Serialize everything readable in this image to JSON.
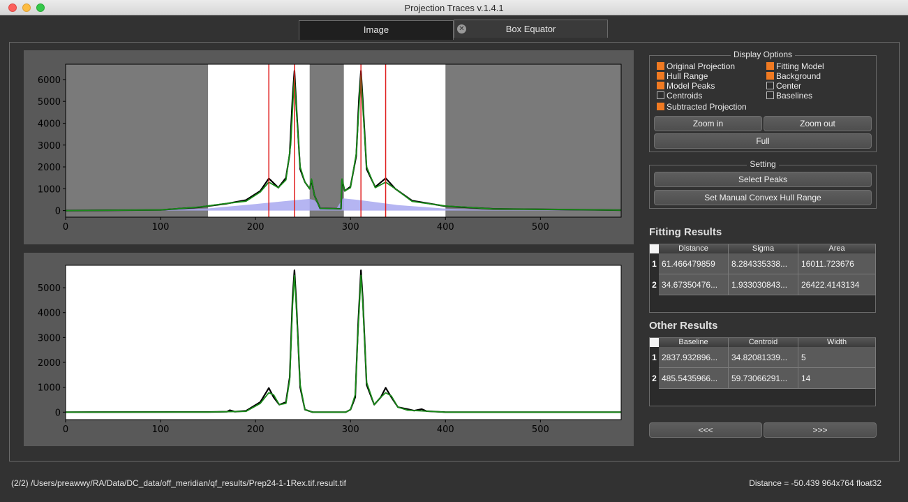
{
  "window": {
    "title": "Projection Traces v.1.4.1"
  },
  "tabs": [
    {
      "label": "Image"
    },
    {
      "label": "Box Equator"
    }
  ],
  "display_options": {
    "title": "Display Options",
    "items": [
      {
        "label": "Original Projection",
        "checked": true
      },
      {
        "label": "Fitting Model",
        "checked": true
      },
      {
        "label": "Hull Range",
        "checked": true
      },
      {
        "label": "Background",
        "checked": true
      },
      {
        "label": "Model Peaks",
        "checked": true
      },
      {
        "label": "Center",
        "checked": false
      },
      {
        "label": "Centroids",
        "checked": false
      },
      {
        "label": "Baselines",
        "checked": false
      },
      {
        "label": "Subtracted Projection",
        "checked": true
      }
    ],
    "zoom_in": "Zoom in",
    "zoom_out": "Zoom out",
    "full": "Full"
  },
  "setting": {
    "title": "Setting",
    "select_peaks": "Select Peaks",
    "set_hull_range": "Set Manual Convex Hull Range"
  },
  "fitting_results": {
    "title": "Fitting Results",
    "columns": [
      "Distance",
      "Sigma",
      "Area"
    ],
    "rows": [
      {
        "index": "1",
        "cells": [
          "61.466479859",
          "8.284335338...",
          "16011.723676"
        ]
      },
      {
        "index": "2",
        "cells": [
          "34.67350476...",
          "1.933030843...",
          "26422.4143134"
        ]
      }
    ]
  },
  "other_results": {
    "title": "Other Results",
    "columns": [
      "Baseline",
      "Centroid",
      "Width"
    ],
    "rows": [
      {
        "index": "1",
        "cells": [
          "2837.932896...",
          "34.82081339...",
          "5"
        ]
      },
      {
        "index": "2",
        "cells": [
          "485.5435966...",
          "59.73066291...",
          "14"
        ]
      }
    ]
  },
  "navigation": {
    "prev": "<<<",
    "next": ">>>"
  },
  "status": {
    "path": "(2/2) /Users/preawwy/RA/Data/DC_data/off_meridian/qf_results/Prep24-1-1Rex.tif.result.tif",
    "info": "Distance = -50.439  964x764 float32"
  },
  "chart_data": [
    {
      "type": "line",
      "xlim": [
        0,
        585
      ],
      "ylim": [
        -300,
        6700
      ],
      "x_ticks": [
        0,
        100,
        200,
        300,
        400,
        500
      ],
      "y_ticks": [
        0,
        1000,
        2000,
        3000,
        4000,
        5000,
        6000
      ],
      "hull_range": [
        [
          150,
          257
        ],
        [
          293,
          400
        ]
      ],
      "model_peaks_x": [
        214,
        241,
        311,
        337
      ],
      "series": [
        {
          "color": "#000000",
          "points": [
            [
              0,
              0
            ],
            [
              100,
              30
            ],
            [
              140,
              150
            ],
            [
              170,
              320
            ],
            [
              190,
              480
            ],
            [
              205,
              900
            ],
            [
              214,
              1470
            ],
            [
              224,
              1050
            ],
            [
              232,
              1500
            ],
            [
              236,
              2600
            ],
            [
              239,
              5200
            ],
            [
              241,
              6400
            ],
            [
              243,
              4800
            ],
            [
              247,
              1900
            ],
            [
              252,
              1300
            ],
            [
              257,
              1000
            ],
            [
              259,
              1400
            ],
            [
              262,
              700
            ],
            [
              268,
              100
            ],
            [
              290,
              80
            ],
            [
              291,
              1400
            ],
            [
              294,
              900
            ],
            [
              300,
              1100
            ],
            [
              306,
              2500
            ],
            [
              309,
              5200
            ],
            [
              311,
              6400
            ],
            [
              313,
              5000
            ],
            [
              317,
              1900
            ],
            [
              326,
              1080
            ],
            [
              337,
              1480
            ],
            [
              347,
              1000
            ],
            [
              365,
              450
            ],
            [
              400,
              200
            ],
            [
              450,
              80
            ],
            [
              585,
              20
            ]
          ]
        },
        {
          "color": "#1a8a1a",
          "points": [
            [
              0,
              0
            ],
            [
              100,
              30
            ],
            [
              140,
              160
            ],
            [
              170,
              330
            ],
            [
              190,
              430
            ],
            [
              205,
              850
            ],
            [
              214,
              1300
            ],
            [
              224,
              1050
            ],
            [
              232,
              1400
            ],
            [
              237,
              3000
            ],
            [
              240,
              5500
            ],
            [
              241,
              6100
            ],
            [
              243,
              4600
            ],
            [
              247,
              2000
            ],
            [
              252,
              1300
            ],
            [
              257,
              1000
            ],
            [
              259,
              1450
            ],
            [
              262,
              700
            ],
            [
              268,
              100
            ],
            [
              290,
              80
            ],
            [
              291,
              1450
            ],
            [
              294,
              900
            ],
            [
              300,
              1050
            ],
            [
              306,
              2600
            ],
            [
              310,
              5500
            ],
            [
              311,
              6200
            ],
            [
              313,
              4700
            ],
            [
              317,
              2000
            ],
            [
              326,
              1050
            ],
            [
              337,
              1300
            ],
            [
              347,
              1000
            ],
            [
              365,
              420
            ],
            [
              400,
              210
            ],
            [
              450,
              80
            ],
            [
              585,
              20
            ]
          ]
        },
        {
          "color": "#a8a8f0",
          "fill": true,
          "points": [
            [
              0,
              0
            ],
            [
              100,
              20
            ],
            [
              150,
              100
            ],
            [
              200,
              300
            ],
            [
              240,
              470
            ],
            [
              257,
              530
            ],
            [
              262,
              480
            ],
            [
              270,
              80
            ],
            [
              285,
              80
            ],
            [
              292,
              560
            ],
            [
              310,
              480
            ],
            [
              350,
              250
            ],
            [
              400,
              90
            ],
            [
              450,
              20
            ],
            [
              585,
              0
            ]
          ]
        }
      ]
    },
    {
      "type": "line",
      "xlim": [
        0,
        585
      ],
      "ylim": [
        -300,
        5900
      ],
      "x_ticks": [
        0,
        100,
        200,
        300,
        400,
        500
      ],
      "y_ticks": [
        0,
        1000,
        2000,
        3000,
        4000,
        5000
      ],
      "series": [
        {
          "color": "#000000",
          "points": [
            [
              0,
              0
            ],
            [
              150,
              5
            ],
            [
              170,
              20
            ],
            [
              173,
              80
            ],
            [
              178,
              20
            ],
            [
              190,
              50
            ],
            [
              205,
              400
            ],
            [
              214,
              970
            ],
            [
              219,
              600
            ],
            [
              225,
              300
            ],
            [
              232,
              400
            ],
            [
              236,
              1400
            ],
            [
              239,
              4600
            ],
            [
              241,
              5700
            ],
            [
              243,
              4400
            ],
            [
              247,
              1000
            ],
            [
              252,
              100
            ],
            [
              260,
              0
            ],
            [
              295,
              0
            ],
            [
              300,
              100
            ],
            [
              305,
              600
            ],
            [
              308,
              3500
            ],
            [
              311,
              5700
            ],
            [
              313,
              4500
            ],
            [
              317,
              1100
            ],
            [
              325,
              300
            ],
            [
              332,
              600
            ],
            [
              337,
              980
            ],
            [
              343,
              600
            ],
            [
              350,
              200
            ],
            [
              360,
              120
            ],
            [
              367,
              60
            ],
            [
              375,
              120
            ],
            [
              380,
              40
            ],
            [
              400,
              0
            ],
            [
              585,
              0
            ]
          ]
        },
        {
          "color": "#1a8a1a",
          "points": [
            [
              0,
              0
            ],
            [
              150,
              5
            ],
            [
              190,
              30
            ],
            [
              205,
              350
            ],
            [
              214,
              780
            ],
            [
              219,
              700
            ],
            [
              225,
              300
            ],
            [
              232,
              350
            ],
            [
              236,
              1300
            ],
            [
              239,
              4300
            ],
            [
              241,
              5500
            ],
            [
              243,
              4200
            ],
            [
              247,
              1100
            ],
            [
              252,
              100
            ],
            [
              260,
              0
            ],
            [
              295,
              0
            ],
            [
              300,
              100
            ],
            [
              305,
              700
            ],
            [
              308,
              3300
            ],
            [
              311,
              5500
            ],
            [
              313,
              4300
            ],
            [
              317,
              1200
            ],
            [
              325,
              300
            ],
            [
              332,
              600
            ],
            [
              337,
              780
            ],
            [
              343,
              650
            ],
            [
              350,
              200
            ],
            [
              360,
              80
            ],
            [
              400,
              0
            ],
            [
              585,
              0
            ]
          ]
        }
      ]
    }
  ]
}
